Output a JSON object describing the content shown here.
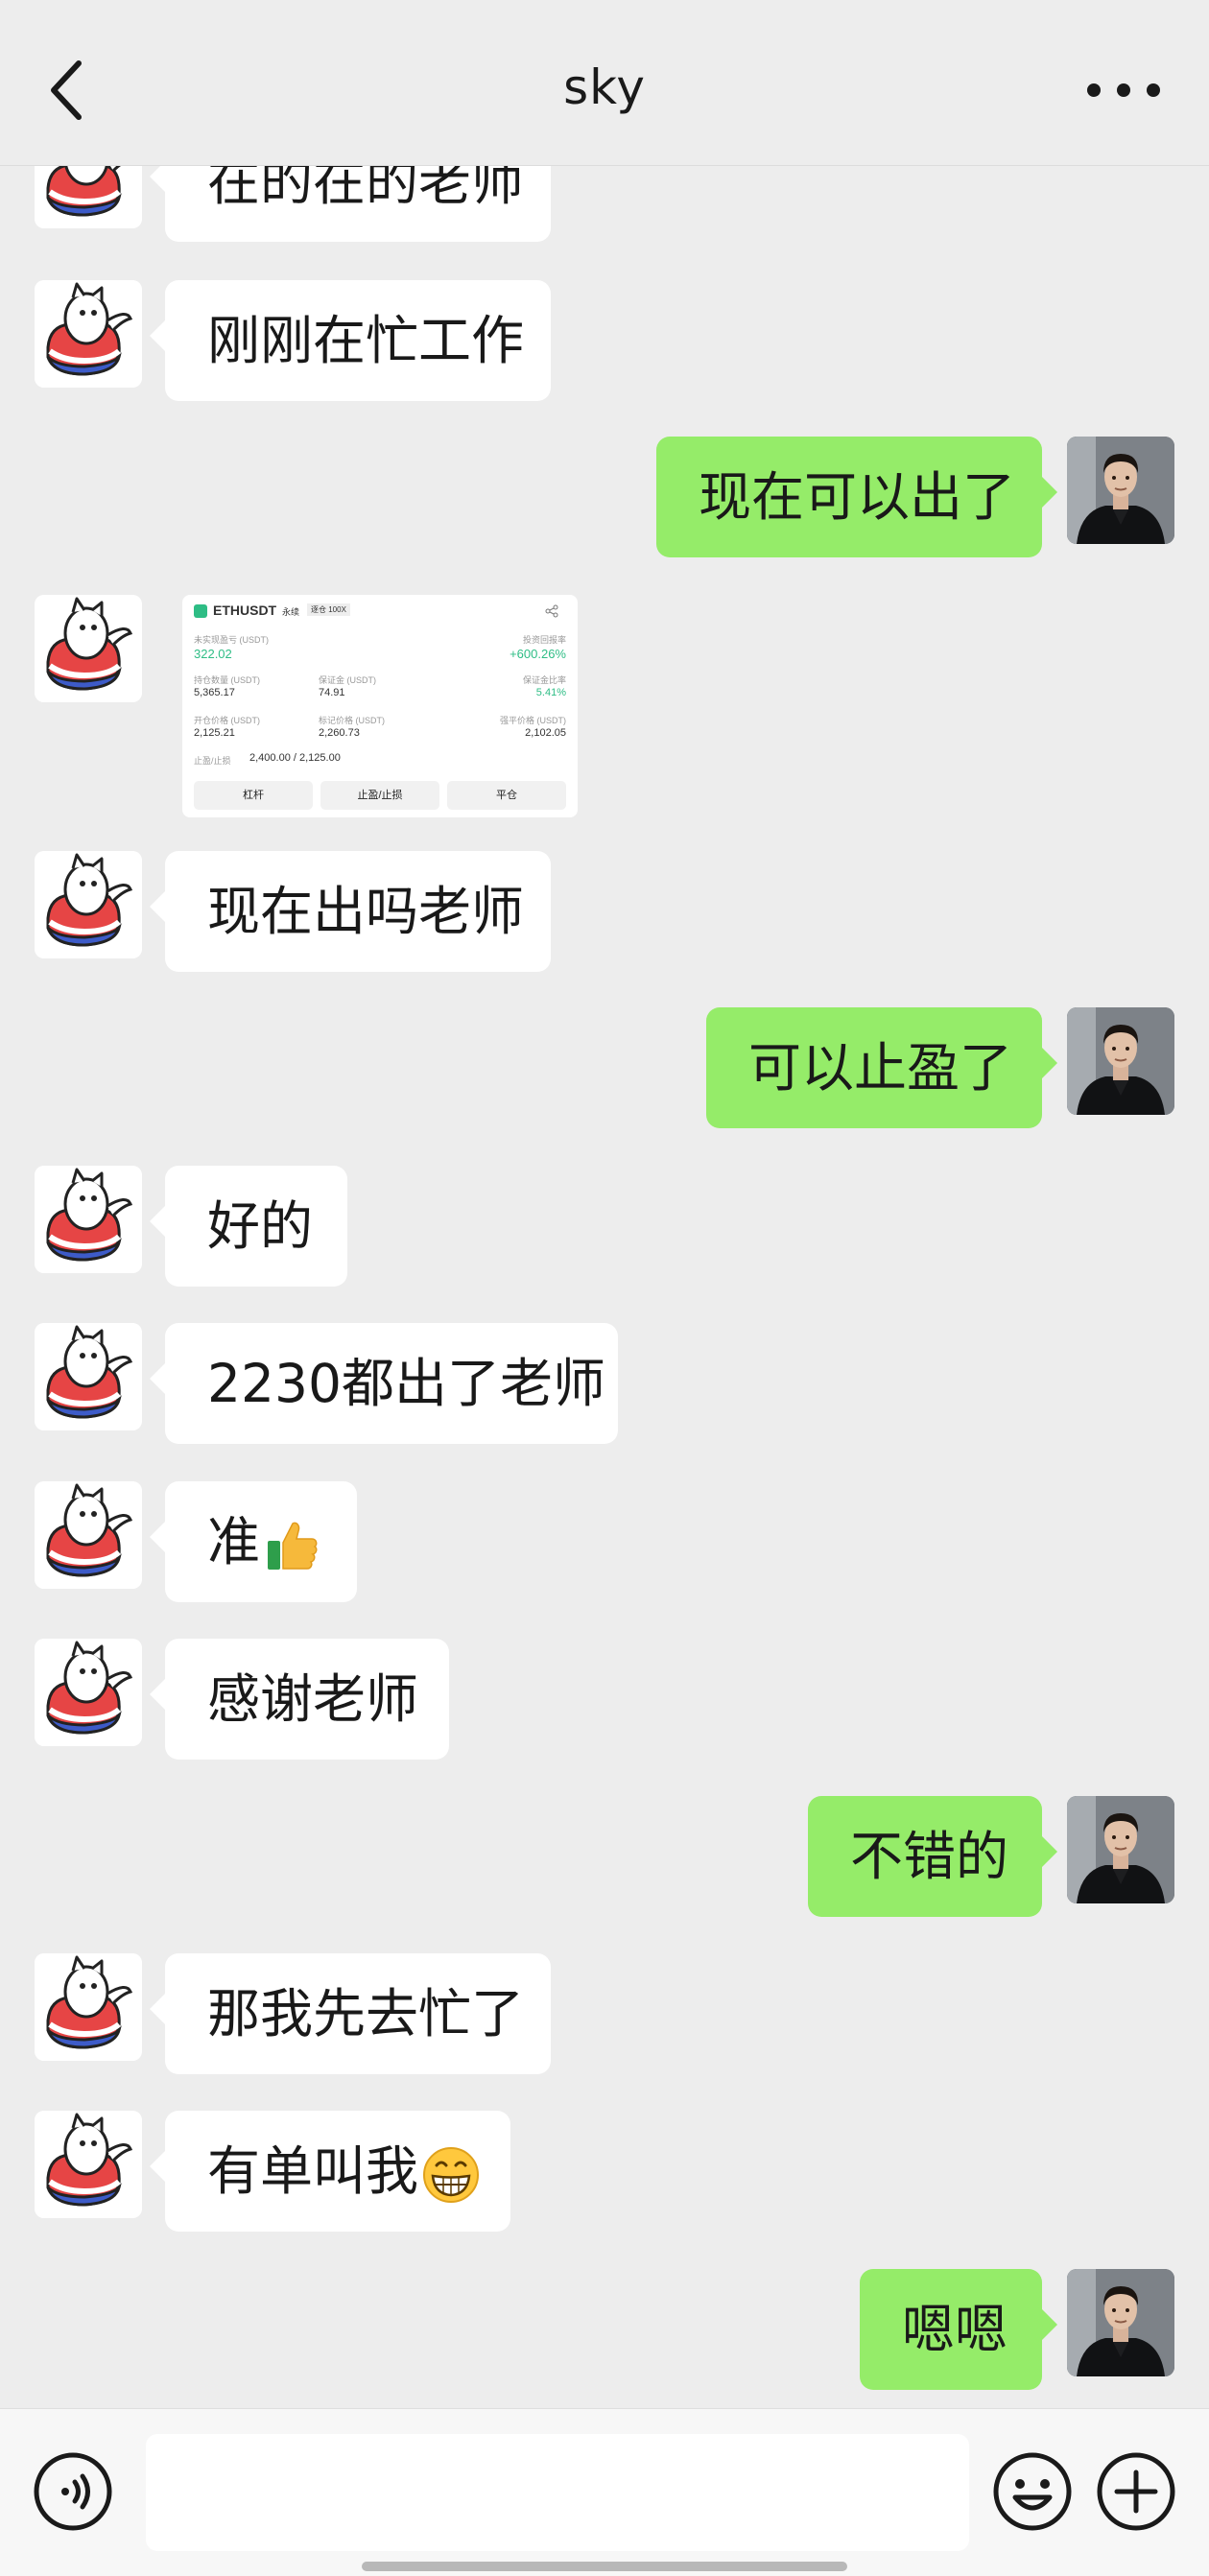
{
  "header": {
    "title": "sky"
  },
  "messages": [
    {
      "side": "in",
      "type": "text",
      "text": "在的在的老师"
    },
    {
      "side": "in",
      "type": "text",
      "text": "刚刚在忙工作"
    },
    {
      "side": "out",
      "type": "text",
      "text": "现在可以出了"
    },
    {
      "side": "in",
      "type": "image"
    },
    {
      "side": "in",
      "type": "text",
      "text": "现在出吗老师"
    },
    {
      "side": "out",
      "type": "text",
      "text": "可以止盈了"
    },
    {
      "side": "in",
      "type": "text",
      "text": "好的"
    },
    {
      "side": "in",
      "type": "text",
      "text": "2230都出了老师"
    },
    {
      "side": "in",
      "type": "text",
      "text": "准",
      "emoji": "thumbs-up"
    },
    {
      "side": "in",
      "type": "text",
      "text": "感谢老师"
    },
    {
      "side": "out",
      "type": "text",
      "text": "不错的"
    },
    {
      "side": "in",
      "type": "text",
      "text": "那我先去忙了"
    },
    {
      "side": "in",
      "type": "text",
      "text": "有单叫我",
      "emoji": "grinning-face"
    },
    {
      "side": "out",
      "type": "text",
      "text": "嗯嗯"
    }
  ],
  "trade_card": {
    "symbol": "ETHUSDT",
    "kind": "永续",
    "mode": "逐仓 100X",
    "pnl_label": "未实现盈亏 (USDT)",
    "pnl_value": "322.02",
    "roe_label": "投资回报率",
    "roe_value": "+600.26%",
    "size_label": "持仓数量 (USDT)",
    "size_value": "5,365.17",
    "margin_label": "保证金 (USDT)",
    "margin_value": "74.91",
    "margin_ratio_label": "保证金比率",
    "margin_ratio_value": "5.41%",
    "entry_label": "开仓价格 (USDT)",
    "entry_value": "2,125.21",
    "mark_label": "标记价格 (USDT)",
    "mark_value": "2,260.73",
    "liq_label": "强平价格 (USDT)",
    "liq_value": "2,102.05",
    "tpsl_label": "止盈/止损",
    "tpsl_value": "2,400.00 / 2,125.00",
    "btn_leverage": "杠杆",
    "btn_tpsl": "止盈/止损",
    "btn_close": "平仓"
  },
  "input": {
    "placeholder": ""
  },
  "colors": {
    "incoming_bubble": "#ffffff",
    "outgoing_bubble": "#95ec69",
    "background": "#ededed"
  },
  "icons": [
    "back-arrow-icon",
    "more-dots-icon",
    "voice-icon",
    "emoji-icon",
    "plus-icon"
  ]
}
